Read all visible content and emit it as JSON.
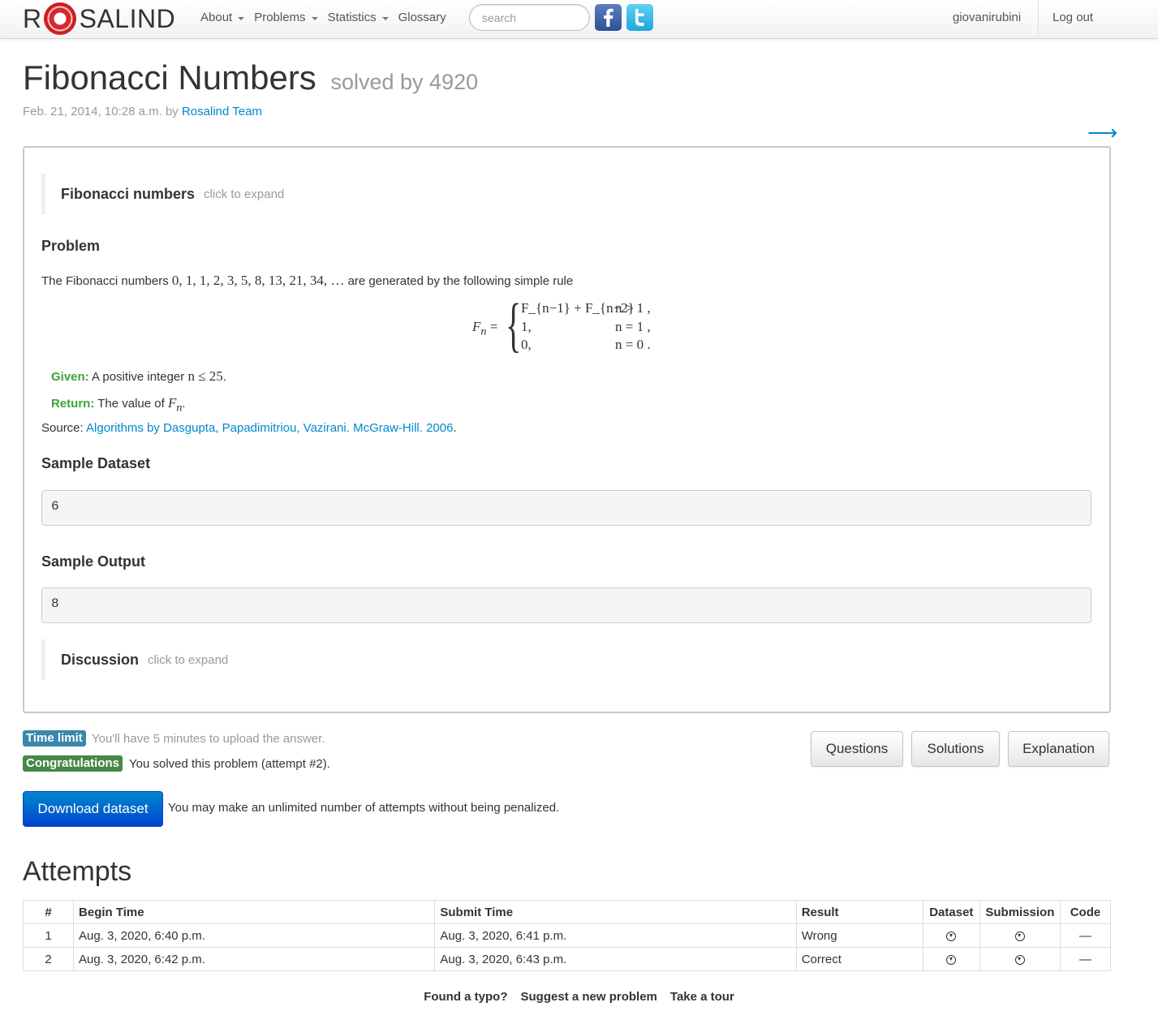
{
  "nav": {
    "logo_left": "R",
    "logo_right": "SALIND",
    "menu": [
      {
        "label": "About",
        "dropdown": true
      },
      {
        "label": "Problems",
        "dropdown": true
      },
      {
        "label": "Statistics",
        "dropdown": true
      },
      {
        "label": "Glossary",
        "dropdown": false
      }
    ],
    "search_placeholder": "search",
    "user": "giovanirubini",
    "logout": "Log out"
  },
  "header": {
    "title": "Fibonacci Numbers",
    "solved_by": "solved by 4920",
    "date": "Feb. 21, 2014, 10:28 a.m. by ",
    "author": "Rosalind Team",
    "next_arrow": "⟶"
  },
  "problem": {
    "intro_title": "Fibonacci numbers",
    "expand_hint": "click to expand",
    "section_title": "Problem",
    "statement_before": "The Fibonacci numbers ",
    "sequence": "0, 1, 1, 2, 3, 5, 8, 13, 21, 34, …",
    "statement_after": " are generated by the following simple rule",
    "formula": {
      "lhs": "F",
      "lhs_sub": "n",
      "cases": [
        {
          "value": "F_{n−1} + F_{n−2}",
          "condition": "n > 1 ,"
        },
        {
          "value": "1,",
          "condition": "n = 1 ,"
        },
        {
          "value": "0,",
          "condition": "n = 0 ."
        }
      ]
    },
    "given_label": "Given:",
    "given_text": " A positive integer ",
    "given_math": "n ≤ 25",
    "return_label": "Return:",
    "return_text": " The value of ",
    "return_math": "F",
    "return_math_sub": "n",
    "source_label": "Source: ",
    "source_link": "Algorithms by Dasgupta, Papadimitriou, Vazirani. McGraw-Hill. 2006",
    "sample_dataset_title": "Sample Dataset",
    "sample_dataset": "6",
    "sample_output_title": "Sample Output",
    "sample_output": "8",
    "discussion_title": "Discussion"
  },
  "status": {
    "time_limit_label": "Time limit",
    "time_limit_text": "You'll have 5 minutes to upload the answer.",
    "congrats_label": "Congratulations",
    "congrats_text": "You solved this problem (attempt #2).",
    "download_button": "Download dataset",
    "attempts_note": "You may make an unlimited number of attempts without being penalized.",
    "buttons": {
      "questions": "Questions",
      "solutions": "Solutions",
      "explanation": "Explanation"
    }
  },
  "attempts": {
    "title": "Attempts",
    "headers": [
      "#",
      "Begin Time",
      "Submit Time",
      "Result",
      "Dataset",
      "Submission",
      "Code"
    ],
    "rows": [
      {
        "num": "1",
        "begin": "Aug. 3, 2020, 6:40 p.m.",
        "submit": "Aug. 3, 2020, 6:41 p.m.",
        "result": "Wrong",
        "code": "—"
      },
      {
        "num": "2",
        "begin": "Aug. 3, 2020, 6:42 p.m.",
        "submit": "Aug. 3, 2020, 6:43 p.m.",
        "result": "Correct",
        "code": "—"
      }
    ]
  },
  "footer": {
    "typo": "Found a typo?",
    "suggest": "Suggest a new problem",
    "tour": "Take a tour"
  },
  "colors": {
    "link": "#0088cc",
    "green_label": "#3ba43b",
    "info_badge": "#3a87ad",
    "success_badge": "#468847",
    "primary_button": "#0055cc"
  }
}
